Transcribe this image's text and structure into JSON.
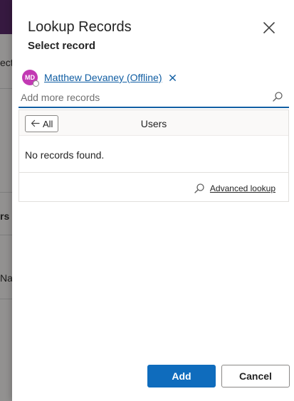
{
  "background": {
    "fragments": [
      "ect",
      "rs",
      "Nar"
    ],
    "header_color": "#5b2a6b"
  },
  "dialog": {
    "title": "Lookup Records",
    "subtitle": "Select record",
    "close_icon": "close-icon"
  },
  "lookup": {
    "selected": {
      "initials": "MD",
      "name": "Matthew Devaney (Offline)",
      "avatar_color": "#c239b3",
      "remove_icon": "close-icon"
    },
    "placeholder": "Add more records",
    "value": "",
    "search_icon": "search-icon"
  },
  "results": {
    "back_label": "All",
    "back_icon": "arrow-left-icon",
    "entity": "Users",
    "empty_message": "No records found.",
    "advanced_lookup_label": "Advanced lookup",
    "advanced_lookup_icon": "search-icon"
  },
  "footer": {
    "add_label": "Add",
    "cancel_label": "Cancel"
  },
  "colors": {
    "accent": "#0f6cbd",
    "link": "#115ea3"
  }
}
